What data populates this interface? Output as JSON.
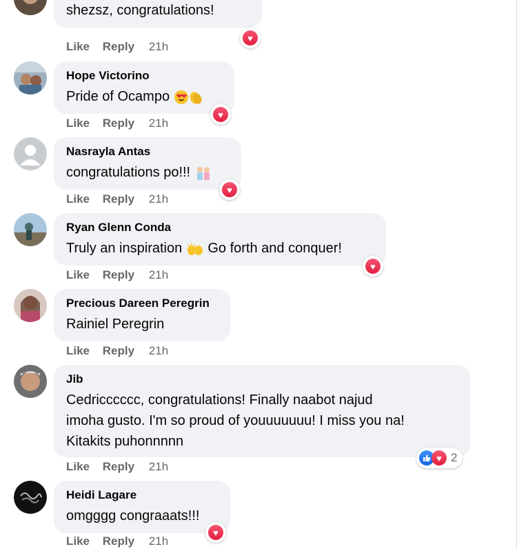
{
  "actions": {
    "like": "Like",
    "reply": "Reply"
  },
  "comments": [
    {
      "author": "",
      "text": "shezsz, congratulations!",
      "time": "21h"
    },
    {
      "author": "Hope Victorino",
      "text": "Pride of Ocampo",
      "time": "21h"
    },
    {
      "author": "Nasrayla Antas",
      "text": "congratulations po!!!",
      "time": "21h"
    },
    {
      "author": "Ryan Glenn Conda",
      "text_a": "Truly an inspiration",
      "text_b": "Go forth and conquer!",
      "time": "21h"
    },
    {
      "author": "Precious Dareen Peregrin",
      "text": "Rainiel Peregrin",
      "time": "21h"
    },
    {
      "author": "Jib",
      "lines": [
        "Cedricccccc, congratulations! Finally naabot najud",
        "imoha gusto. I'm so proud of youuuuuuu! I miss you na!",
        "Kitakits puhonnnnn"
      ],
      "time": "21h",
      "reaction_count": "2"
    },
    {
      "author": "Heidi Lagare",
      "text": "omgggg congraaats!!!",
      "time": "21h"
    }
  ],
  "colors": {
    "bubble": "#f0f2f5",
    "meta": "#65676b",
    "text": "#050505",
    "heart": "#e41e3f",
    "like": "#1877f2"
  },
  "icons": {
    "love_reaction": "heart-icon",
    "like_reaction": "thumbs-up-icon",
    "heart_eyes": "heart-eyes-emoji",
    "clap": "clapping-hands-emoji",
    "celebrate": "celebrating-people-emoji",
    "raised_hands": "raised-hands-emoji"
  }
}
